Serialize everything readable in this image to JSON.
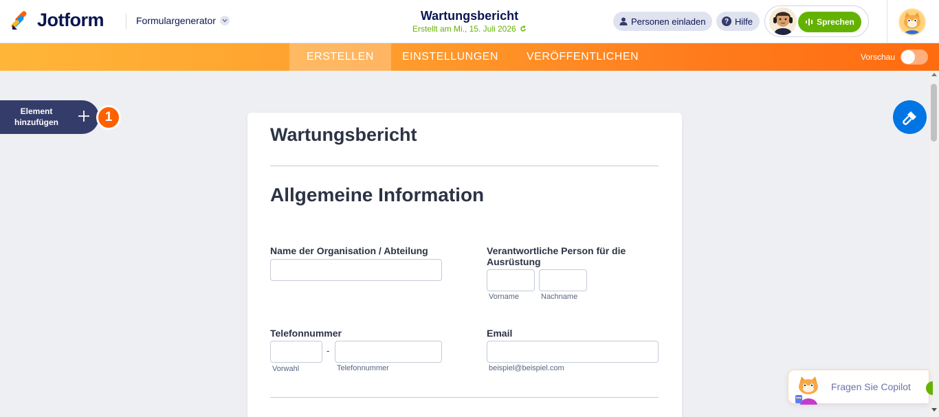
{
  "header": {
    "logo_text": "Jotform",
    "form_generator_label": "Formulargenerator",
    "title": "Wartungsbericht",
    "created_text": "Erstellt am Mi., 15. Juli 2026",
    "invite_label": "Personen einladen",
    "help_label": "Hilfe",
    "help_icon_glyph": "?",
    "speak_label": "Sprechen"
  },
  "nav": {
    "tabs": [
      "ERSTELLEN",
      "EINSTELLUNGEN",
      "VERÖFFENTLICHEN"
    ],
    "active_tab": "ERSTELLEN",
    "preview_label": "Vorschau"
  },
  "sidebar": {
    "add_element_label": "Element hinzufügen",
    "badge_count": "1"
  },
  "form": {
    "title": "Wartungsbericht",
    "section_title": "Allgemeine Information",
    "fields": {
      "organisation": {
        "label": "Name der Organisation / Abteilung",
        "value": ""
      },
      "responsible": {
        "label": "Verantwortliche Person für die Ausrüstung",
        "first_sub": "Vorname",
        "last_sub": "Nachname"
      },
      "phone": {
        "label": "Telefonnummer",
        "area_sub": "Vorwahl",
        "number_sub": "Telefonnummer",
        "separator": "-"
      },
      "email": {
        "label": "Email",
        "sub": "beispiel@beispiel.com"
      }
    }
  },
  "copilot": {
    "label": "Fragen Sie Copilot"
  },
  "colors": {
    "brand_orange": "#ff6100",
    "navy": "#0a1551",
    "green": "#64b200",
    "blue": "#0075e3"
  }
}
